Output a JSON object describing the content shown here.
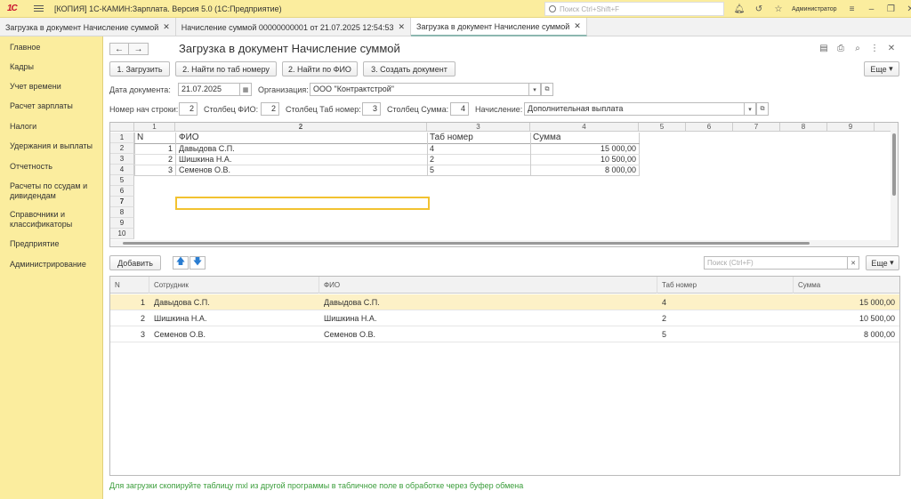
{
  "titlebar": {
    "logo": "1С",
    "title": "[КОПИЯ] 1С-КАМИН:Зарплата. Версия 5.0  (1С:Предприятие)",
    "search_placeholder": "Поиск Ctrl+Shift+F",
    "user": "Администратор"
  },
  "tabs": [
    {
      "label": "Загрузка в документ Начисление суммой"
    },
    {
      "label": "Начисление суммой 00000000001 от 21.07.2025 12:54:53"
    },
    {
      "label": "Загрузка в документ Начисление суммой"
    }
  ],
  "sidebar": {
    "items": [
      {
        "label": "Главное"
      },
      {
        "label": "Кадры"
      },
      {
        "label": "Учет времени"
      },
      {
        "label": "Расчет зарплаты"
      },
      {
        "label": "Налоги"
      },
      {
        "label": "Удержания и выплаты"
      },
      {
        "label": "Отчетность"
      },
      {
        "label": "Расчеты по ссудам и дивидендам"
      },
      {
        "label": "Справочники и классификаторы"
      },
      {
        "label": "Предприятие"
      },
      {
        "label": "Администрирование"
      }
    ]
  },
  "form": {
    "title": "Загрузка в документ Начисление суммой",
    "buttons": {
      "load": "1. Загрузить",
      "find_tab": "2. Найти по таб номеру",
      "find_fio": "2. Найти по ФИО",
      "create_doc": "3. Создать документ",
      "more": "Еще"
    },
    "doc_date_label": "Дата документа:",
    "doc_date_value": "21.07.2025",
    "org_label": "Организация:",
    "org_value": "ООО \"Контрактстрой\"",
    "start_row_label": "Номер нач строки:",
    "start_row_value": "2",
    "fio_col_label": "Столбец ФИО:",
    "fio_col_value": "2",
    "tab_col_label": "Столбец Таб номер:",
    "tab_col_value": "3",
    "sum_col_label": "Столбец Сумма:",
    "sum_col_value": "4",
    "accrual_label": "Начисление:",
    "accrual_value": "Дополнительная выплата"
  },
  "sheet": {
    "col_headers": [
      "1",
      "2",
      "3",
      "4",
      "5",
      "6",
      "7",
      "8",
      "9"
    ],
    "row_headers": [
      "1",
      "2",
      "3",
      "4",
      "5",
      "6",
      "7",
      "8",
      "9",
      "10"
    ],
    "header_row": {
      "n": "N",
      "fio": "ФИО",
      "tab": "Таб номер",
      "sum": "Сумма"
    },
    "rows": [
      {
        "n": "1",
        "fio": "Давыдова С.П.",
        "tab": "4",
        "sum": "15 000,00"
      },
      {
        "n": "2",
        "fio": "Шишкина Н.А.",
        "tab": "2",
        "sum": "10 500,00"
      },
      {
        "n": "3",
        "fio": "Семенов О.В.",
        "tab": "5",
        "sum": "8 000,00"
      }
    ]
  },
  "table": {
    "add_label": "Добавить",
    "search_placeholder": "Поиск (Ctrl+F)",
    "more": "Еще",
    "headers": {
      "n": "N",
      "employee": "Сотрудник",
      "fio": "ФИО",
      "tab": "Таб номер",
      "sum": "Сумма"
    },
    "rows": [
      {
        "n": "1",
        "employee": "Давыдова С.П.",
        "fio": "Давыдова С.П.",
        "tab": "4",
        "sum": "15 000,00"
      },
      {
        "n": "2",
        "employee": "Шишкина Н.А.",
        "fio": "Шишкина Н.А.",
        "tab": "2",
        "sum": "10 500,00"
      },
      {
        "n": "3",
        "employee": "Семенов О.В.",
        "fio": "Семенов О.В.",
        "tab": "5",
        "sum": "8 000,00"
      }
    ]
  },
  "hint": "Для загрузки скопируйте таблицу mxl из другой программы в табличное поле в обработке через буфер обмена"
}
